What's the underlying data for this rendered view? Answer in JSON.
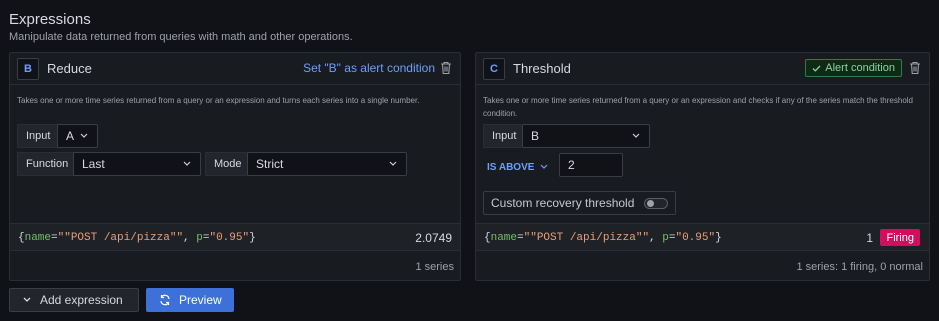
{
  "section": {
    "title": "Expressions",
    "subtitle": "Manipulate data returned from queries with math and other operations."
  },
  "colors": {
    "background": "#111217",
    "panel": "#181b1f",
    "accent_blue": "#6e9fff",
    "primary_button": "#3d71d9",
    "firing": "#d10e5c",
    "alert_condition": "#2d7d45"
  },
  "expression_b": {
    "ref_id": "B",
    "name": "Reduce",
    "set_alert_label": "Set \"B\" as alert condition",
    "delete_icon": "trash-icon",
    "description": "Takes one or more time series returned from a query or an expression and turns each series into a single number.",
    "input_label": "Input",
    "input_value": "A",
    "function_label": "Function",
    "function_value": "Last",
    "mode_label": "Mode",
    "mode_value": "Strict",
    "result": {
      "open_brace": "{",
      "name_key": "name",
      "name_value": "\"\"POST /api/pizza\"\"",
      "sep": ", ",
      "p_key": "p",
      "p_value": "\"0.95\"",
      "close_brace": "}",
      "value": "2.0749"
    },
    "summary": "1 series"
  },
  "expression_c": {
    "ref_id": "C",
    "name": "Threshold",
    "alert_condition_label": "Alert condition",
    "delete_icon": "trash-icon",
    "description": "Takes one or more time series returned from a query or an expression and checks if any of the series match the threshold condition.",
    "input_label": "Input",
    "input_value": "B",
    "operator_label": "IS ABOVE",
    "threshold_value": "2",
    "recovery_label": "Custom recovery threshold",
    "recovery_enabled": false,
    "result": {
      "open_brace": "{",
      "name_key": "name",
      "name_value": "\"\"POST /api/pizza\"\"",
      "sep": ", ",
      "p_key": "p",
      "p_value": "\"0.95\"",
      "close_brace": "}",
      "value": "1",
      "state": "Firing"
    },
    "summary": "1 series: 1 firing, 0 normal"
  },
  "actions": {
    "add_expression_label": "Add expression",
    "preview_label": "Preview"
  }
}
